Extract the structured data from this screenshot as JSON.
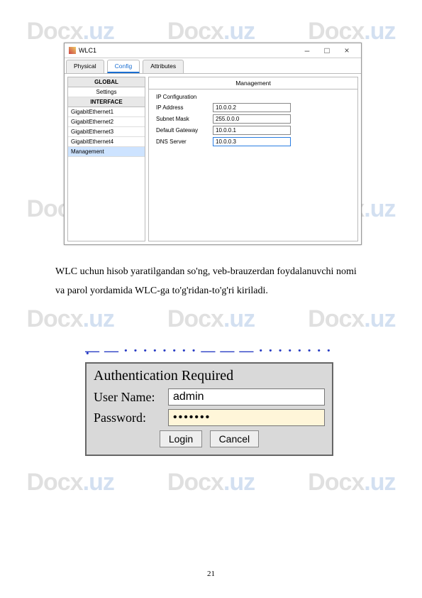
{
  "watermark": "Docx.uz",
  "wlc": {
    "title": "WLC1",
    "tabs": {
      "physical": "Physical",
      "config": "Config",
      "attributes": "Attributes"
    },
    "sidebar": {
      "global": "GLOBAL",
      "settings": "Settings",
      "interface": "INTERFACE",
      "ge1": "GigabitEthernet1",
      "ge2": "GigabitEthernet2",
      "ge3": "GigabitEthernet3",
      "ge4": "GigabitEthernet4",
      "mgmt": "Management"
    },
    "panel": {
      "title": "Management",
      "section": "IP Configuration",
      "ip_label": "IP Address",
      "ip_value": "10.0.0.2",
      "mask_label": "Subnet Mask",
      "mask_value": "255.0.0.0",
      "gw_label": "Default Gateway",
      "gw_value": "10.0.0.1",
      "dns_label": "DNS Server",
      "dns_value": "10.0.0.3"
    }
  },
  "paragraph": "WLC uchun hisob yaratilgandan so'ng, veb-brauzerdan foydalanuvchi nomi va parol yordamida WLC-ga to'g'ridan-to'g'ri kiriladi.",
  "auth": {
    "title": "Authentication Required",
    "user_label": "User Name:",
    "user_value": "admin",
    "pass_label": "Password:",
    "pass_value": "•••••••",
    "login": "Login",
    "cancel": "Cancel"
  },
  "page_number": "21"
}
